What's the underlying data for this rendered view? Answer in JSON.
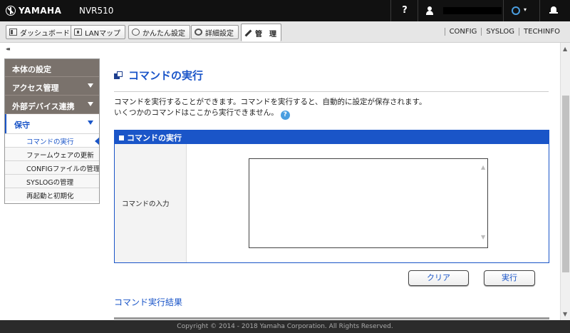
{
  "header": {
    "brand": "YAMAHA",
    "model": "NVR510",
    "help_label": "?",
    "status_caret": "▾"
  },
  "nav": {
    "buttons": [
      {
        "label": "ダッシュボード",
        "icon": "dashboard-icon"
      },
      {
        "label": "LANマップ",
        "icon": "lan-map-icon"
      },
      {
        "label": "かんたん設定",
        "icon": "easy-setup-icon"
      },
      {
        "label": "詳細設定",
        "icon": "gear-icon"
      },
      {
        "label": "管　理",
        "icon": "wrench-icon"
      }
    ],
    "links": [
      "CONFIG",
      "SYSLOG",
      "TECHINFO"
    ]
  },
  "sidebar": {
    "collapse_label": "◂◂",
    "sections": [
      {
        "label": "本体の設定"
      },
      {
        "label": "アクセス管理"
      },
      {
        "label": "外部デバイス連携"
      },
      {
        "label": "保守"
      }
    ],
    "subitems": [
      {
        "label": "コマンドの実行"
      },
      {
        "label": "ファームウェアの更新"
      },
      {
        "label": "CONFIGファイルの管理"
      },
      {
        "label": "SYSLOGの管理"
      },
      {
        "label": "再起動と初期化"
      }
    ]
  },
  "main": {
    "title": "コマンドの実行",
    "desc_line1": "コマンドを実行することができます。コマンドを実行すると、自動的に設定が保存されます。",
    "desc_line2": "いくつかのコマンドはここから実行できません。",
    "help_badge": "?",
    "panel_title": "コマンドの実行",
    "input_label": "コマンドの入力",
    "input_value": "",
    "clear_label": "クリア",
    "run_label": "実行",
    "result_title": "コマンド実行結果"
  },
  "footer": {
    "copyright": "Copyright © 2014 - 2018 Yamaha Corporation. All Rights Reserved."
  },
  "colors": {
    "accent": "#1a55c8",
    "sidebar_bg": "#7a726c",
    "topbar_bg": "#111111"
  }
}
